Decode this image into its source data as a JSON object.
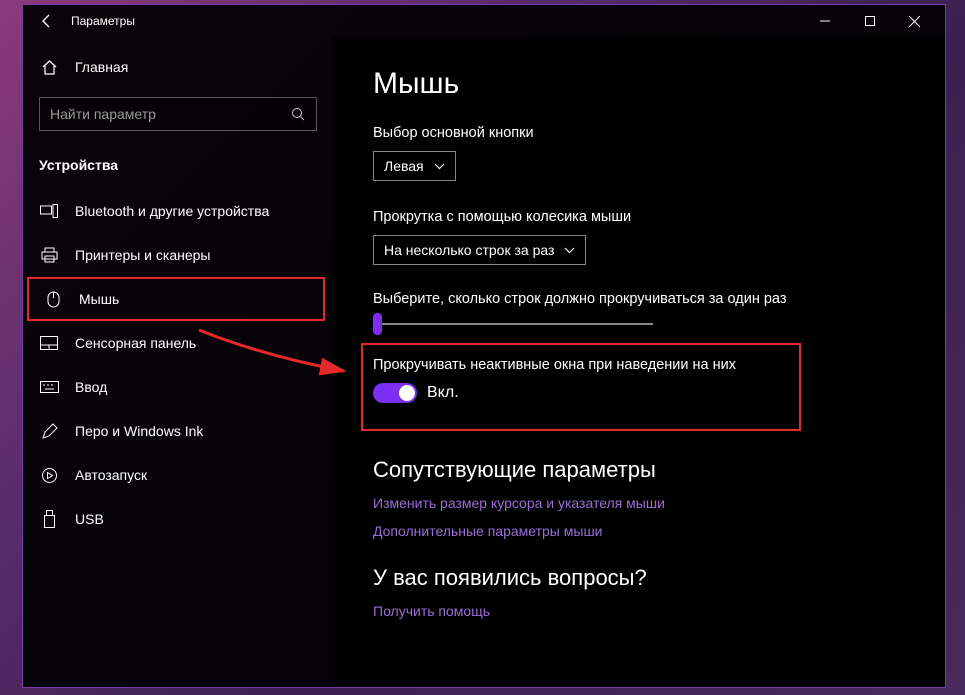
{
  "titlebar": {
    "title": "Параметры"
  },
  "sidebar": {
    "home": "Главная",
    "search_placeholder": "Найти параметр",
    "category": "Устройства",
    "items": [
      {
        "label": "Bluetooth и другие устройства"
      },
      {
        "label": "Принтеры и сканеры"
      },
      {
        "label": "Мышь"
      },
      {
        "label": "Сенсорная панель"
      },
      {
        "label": "Ввод"
      },
      {
        "label": "Перо и Windows Ink"
      },
      {
        "label": "Автозапуск"
      },
      {
        "label": "USB"
      }
    ]
  },
  "main": {
    "heading": "Мышь",
    "primary_button_label": "Выбор основной кнопки",
    "primary_button_value": "Левая",
    "scroll_wheel_label": "Прокрутка с помощью колесика мыши",
    "scroll_wheel_value": "На несколько строк за раз",
    "lines_label": "Выберите, сколько строк должно прокручиваться за один раз",
    "inactive_label": "Прокручивать неактивные окна при наведении на них",
    "toggle_state": "Вкл.",
    "related_heading": "Сопутствующие параметры",
    "link_cursor": "Изменить размер курсора и указателя мыши",
    "link_advanced": "Дополнительные параметры мыши",
    "questions_heading": "У вас появились вопросы?",
    "link_help": "Получить помощь"
  }
}
